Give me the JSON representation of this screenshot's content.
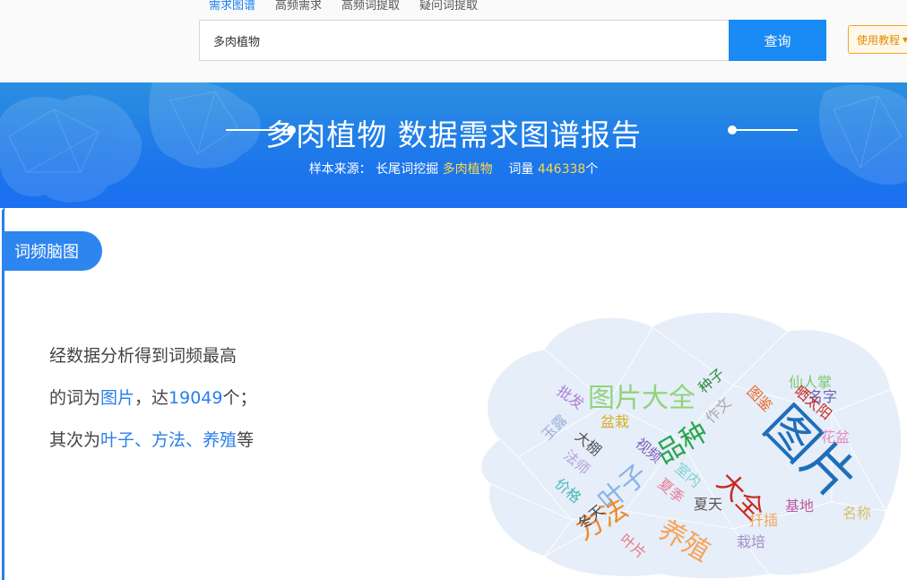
{
  "tabs": [
    "需求图谱",
    "高频需求",
    "高频词提取",
    "疑问词提取"
  ],
  "search": {
    "value": "多肉植物",
    "button": "查询"
  },
  "tutorial": {
    "label": "使用教程",
    "caret": "▾"
  },
  "banner": {
    "title": "多肉植物 数据需求图谱报告",
    "source_label": "样本来源：",
    "source_name": "长尾词挖掘",
    "keyword": "多肉植物",
    "count_label": "词量",
    "count": "446338",
    "count_unit": "个"
  },
  "section": {
    "title": "词频脑图"
  },
  "summary": {
    "line1": "经数据分析得到词频最高",
    "line2_prefix": "的词为",
    "top_word": "图片",
    "line2_mid": "，达",
    "top_count": "19049",
    "line2_suffix": "个；",
    "line3_prefix": "其次为",
    "w1": "叶子",
    "sep1": "、",
    "w2": "方法",
    "sep2": "、",
    "w3": "养殖",
    "line3_suffix": "等"
  },
  "cloud_words": [
    {
      "text": "图片",
      "color": "#1f6fb8"
    },
    {
      "text": "图片大全",
      "color": "#8fd47a"
    },
    {
      "text": "品种",
      "color": "#27a54a"
    },
    {
      "text": "大全",
      "color": "#c8281e"
    },
    {
      "text": "叶子",
      "color": "#8ab4e6"
    },
    {
      "text": "方法",
      "color": "#f0892b"
    },
    {
      "text": "养殖",
      "color": "#f5a55a"
    },
    {
      "text": "仙人掌",
      "color": "#7bc86c"
    },
    {
      "text": "名字",
      "color": "#6b5fa8"
    },
    {
      "text": "晒太阳",
      "color": "#c8281e"
    },
    {
      "text": "图鉴",
      "color": "#e8662a"
    },
    {
      "text": "作文",
      "color": "#aaaaaa"
    },
    {
      "text": "种子",
      "color": "#2e8b3a"
    },
    {
      "text": "花盆",
      "color": "#e88ac0"
    },
    {
      "text": "批发",
      "color": "#b07bd4"
    },
    {
      "text": "盆栽",
      "color": "#d4b21e"
    },
    {
      "text": "玉露",
      "color": "#9ab0d8"
    },
    {
      "text": "大棚",
      "color": "#555555"
    },
    {
      "text": "视频",
      "color": "#7a5fb8"
    },
    {
      "text": "法师",
      "color": "#b8a0d8"
    },
    {
      "text": "室内",
      "color": "#7bd4d4"
    },
    {
      "text": "夏季",
      "color": "#e87a9a"
    },
    {
      "text": "夏天",
      "color": "#555555"
    },
    {
      "text": "价格",
      "color": "#4ab8b8"
    },
    {
      "text": "冬天",
      "color": "#444444"
    },
    {
      "text": "基地",
      "color": "#c05aa0"
    },
    {
      "text": "名称",
      "color": "#d4c26a"
    },
    {
      "text": "扦插",
      "color": "#f5a55a"
    },
    {
      "text": "栽培",
      "color": "#a090c8"
    },
    {
      "text": "叶片",
      "color": "#e87a7a"
    }
  ]
}
